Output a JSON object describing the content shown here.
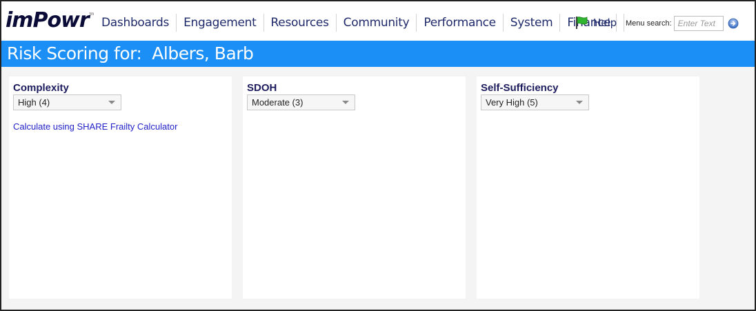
{
  "logo": {
    "text": "imPowr",
    "tm": "tm"
  },
  "nav": {
    "items": [
      "Dashboards",
      "Engagement",
      "Resources",
      "Community",
      "Performance",
      "System",
      "Finance"
    ],
    "help_label": "Help",
    "menu_search_label": "Menu search:",
    "menu_search_placeholder": "Enter Text"
  },
  "header": {
    "title": "Risk Scoring for:  Albers, Barb"
  },
  "panels": [
    {
      "title": "Complexity",
      "selected": "High (4)",
      "link": "Calculate using SHARE Frailty Calculator"
    },
    {
      "title": "SDOH",
      "selected": "Moderate (3)"
    },
    {
      "title": "Self-Sufficiency",
      "selected": "Very High (5)"
    }
  ],
  "colors": {
    "accent": "#1b8ff5",
    "nav_text": "#1f2a6b",
    "link": "#2222c8",
    "flag": "#2fb52f"
  }
}
